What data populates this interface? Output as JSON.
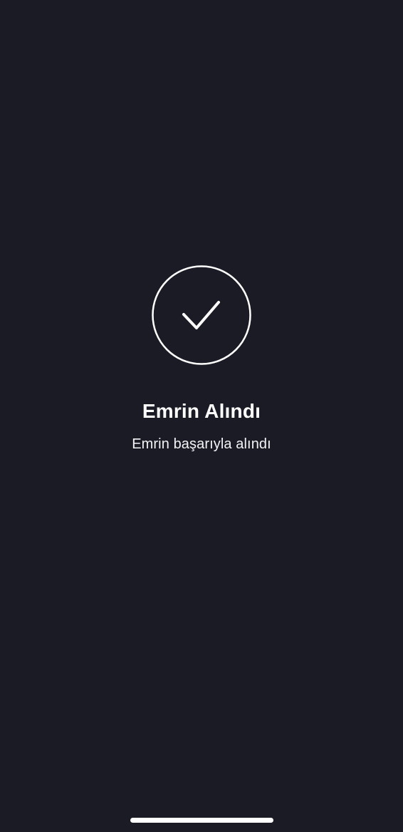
{
  "confirmation": {
    "icon": "checkmark-circle-icon",
    "title": "Emrin Alındı",
    "message": "Emrin başarıyla alındı"
  },
  "colors": {
    "background": "#1b1b26",
    "foreground": "#ffffff"
  }
}
